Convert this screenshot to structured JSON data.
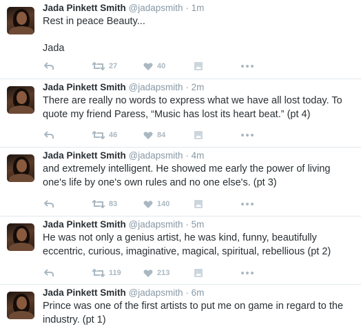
{
  "tweets": [
    {
      "name": "Jada Pinkett Smith",
      "handle": "@jadapsmith",
      "separator": "·",
      "time": "1m",
      "text": "Rest in peace Beauty...\n\nJada",
      "retweets": "27",
      "likes": "40"
    },
    {
      "name": "Jada Pinkett Smith",
      "handle": "@jadapsmith",
      "separator": "·",
      "time": "2m",
      "text": "There are really no words to express what we have all lost today. To quote my friend Paress, “Music has lost its heart beat.” (pt 4)",
      "retweets": "46",
      "likes": "84"
    },
    {
      "name": "Jada Pinkett Smith",
      "handle": "@jadapsmith",
      "separator": "·",
      "time": "4m",
      "text": "and extremely intelligent. He showed me early the power of living one's life by one's own rules and no one else's. (pt 3)",
      "retweets": "83",
      "likes": "140"
    },
    {
      "name": "Jada Pinkett Smith",
      "handle": "@jadapsmith",
      "separator": "·",
      "time": "5m",
      "text": "He was not only a genius artist, he was kind, funny, beautifully eccentric, curious, imaginative, magical, spiritual, rebellious (pt 2)",
      "retweets": "119",
      "likes": "213"
    },
    {
      "name": "Jada Pinkett Smith",
      "handle": "@jadapsmith",
      "separator": "·",
      "time": "6m",
      "text": "Prince was one of the first artists to put me on game in regard to the industry. (pt 1)",
      "retweets": "",
      "likes": ""
    }
  ],
  "icons": {
    "reply": "reply-icon",
    "retweet": "retweet-icon",
    "like": "heart-icon",
    "media": "media-icon",
    "more": "more-dots-icon"
  },
  "colors": {
    "name": "#292f33",
    "meta": "#8899a6",
    "action": "#aab8c2",
    "divider": "#e1e8ed"
  }
}
